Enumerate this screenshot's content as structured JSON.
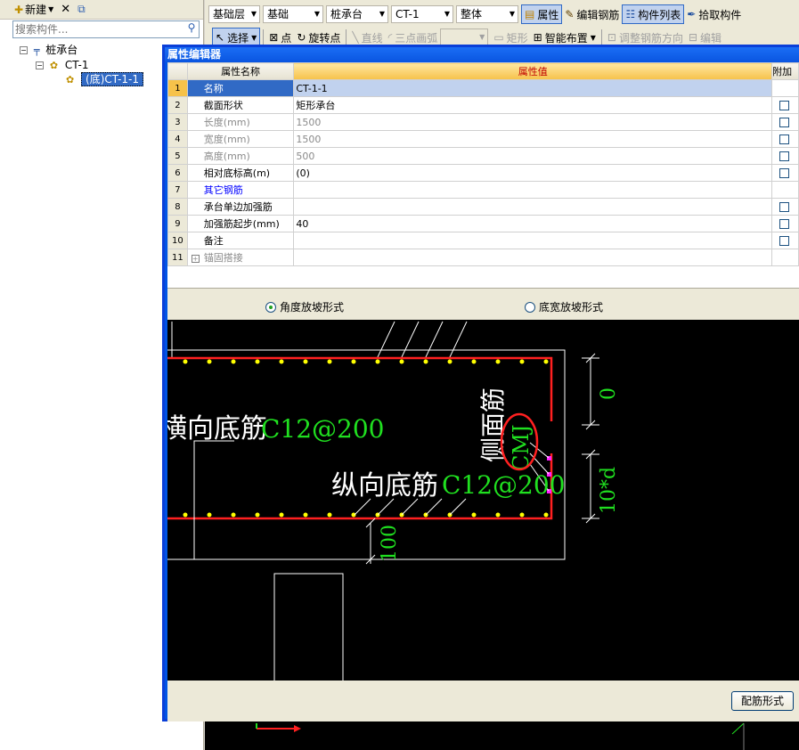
{
  "left_panel": {
    "new_label": "新建",
    "search_placeholder": "搜索构件...",
    "tree": {
      "root": "桩承台",
      "child": "CT-1",
      "leaf": "(底)CT-1-1"
    }
  },
  "toolbar": {
    "row1": {
      "floor": "基础层",
      "category": "基础",
      "type": "桩承台",
      "element": "CT-1",
      "mode": "整体",
      "property_btn": "属性",
      "edit_rebar_btn": "编辑钢筋",
      "element_list_btn": "构件列表",
      "pick_btn": "拾取构件"
    },
    "row2": {
      "select_btn": "选择",
      "point_btn": "点",
      "rotate_point_btn": "旋转点",
      "line_btn": "直线",
      "arc_btn": "三点画弧",
      "rect_btn": "矩形",
      "smart_layout_btn": "智能布置",
      "adjust_rebar_btn": "调整钢筋方向",
      "edit_btn": "编辑"
    }
  },
  "editor": {
    "title": "属性编辑器",
    "columns": [
      "属性名称",
      "属性值",
      "附加"
    ],
    "rows": [
      {
        "num": "1",
        "name": "名称",
        "value": "CT-1-1",
        "checkbox": false
      },
      {
        "num": "2",
        "name": "截面形状",
        "value": "矩形承台",
        "checkbox": true
      },
      {
        "num": "3",
        "name": "长度(mm)",
        "value": "1500",
        "checkbox": true
      },
      {
        "num": "4",
        "name": "宽度(mm)",
        "value": "1500",
        "checkbox": true
      },
      {
        "num": "5",
        "name": "高度(mm)",
        "value": "500",
        "checkbox": true
      },
      {
        "num": "6",
        "name": "相对底标高(m)",
        "value": "(0)",
        "checkbox": true
      },
      {
        "num": "7",
        "name": "其它钢筋",
        "value": "",
        "checkbox": false
      },
      {
        "num": "8",
        "name": "承台单边加强筋",
        "value": "",
        "checkbox": true
      },
      {
        "num": "9",
        "name": "加强筋起步(mm)",
        "value": "40",
        "checkbox": true
      },
      {
        "num": "10",
        "name": "备注",
        "value": "",
        "checkbox": true
      },
      {
        "num": "11",
        "name": "锚固搭接",
        "value": "",
        "checkbox": false
      }
    ],
    "radio_angle": "角度放坡形式",
    "radio_width": "底宽放坡形式",
    "rebar_form_btn": "配筋形式"
  },
  "drawing": {
    "bottom_rebar_h": "横向底筋",
    "bottom_rebar_h_spec": "C12@200",
    "bottom_rebar_v": "纵向底筋",
    "bottom_rebar_v_spec": "C12@200",
    "side_rebar": "侧面筋",
    "side_rebar_code": "CMJ",
    "dim_top": "0",
    "dim_side": "10*d",
    "dim_bottom": "100"
  },
  "colors": {
    "title_bar": "#0055e5",
    "rebar_red": "#ff2020",
    "rebar_dot": "#ffff00",
    "label_green": "#20e020",
    "label_white": "#ffffff",
    "selected_row": "#316ac5",
    "header_value": "#f6c24a"
  }
}
